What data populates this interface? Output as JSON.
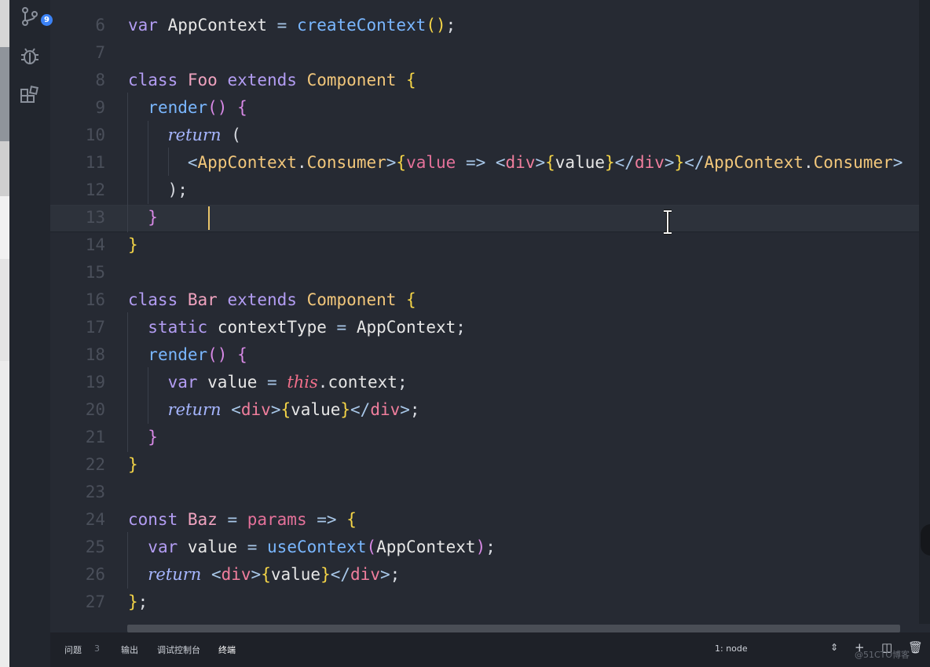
{
  "activity_bar": {
    "icons": [
      "source-control-icon",
      "debug-icon",
      "extensions-icon"
    ],
    "source_control_badge": "9"
  },
  "editor": {
    "lines": [
      {
        "n": "6",
        "tokens": [
          [
            "kw",
            "var "
          ],
          [
            "id",
            "AppContext "
          ],
          [
            "op",
            "= "
          ],
          [
            "fn",
            "createContext"
          ],
          [
            "br",
            "()"
          ],
          [
            "code",
            ";"
          ]
        ]
      },
      {
        "n": "7",
        "tokens": []
      },
      {
        "n": "8",
        "tokens": [
          [
            "kw",
            "class "
          ],
          [
            "ctor",
            "Foo "
          ],
          [
            "kw",
            "extends "
          ],
          [
            "sup",
            "Component "
          ],
          [
            "br",
            "{"
          ]
        ]
      },
      {
        "n": "9",
        "tokens": [
          [
            "code",
            "  "
          ],
          [
            "fn",
            "render"
          ],
          [
            "br2",
            "() {"
          ]
        ]
      },
      {
        "n": "10",
        "tokens": [
          [
            "code",
            "    "
          ],
          [
            "ret it",
            "return"
          ],
          [
            "code",
            " ("
          ]
        ]
      },
      {
        "n": "11",
        "tokens": [
          [
            "code",
            "      "
          ],
          [
            "op",
            "<"
          ],
          [
            "comp",
            "AppContext"
          ],
          [
            "code",
            "."
          ],
          [
            "comp",
            "Consumer"
          ],
          [
            "op",
            ">"
          ],
          [
            "br",
            "{"
          ],
          [
            "prm",
            "value "
          ],
          [
            "op",
            "=> "
          ],
          [
            "op",
            "<"
          ],
          [
            "tag",
            "div"
          ],
          [
            "op",
            ">"
          ],
          [
            "br",
            "{"
          ],
          [
            "id",
            "value"
          ],
          [
            "br",
            "}"
          ],
          [
            "op",
            "</"
          ],
          [
            "tag",
            "div"
          ],
          [
            "op",
            ">"
          ],
          [
            "br",
            "}"
          ],
          [
            "op",
            "</"
          ],
          [
            "comp",
            "AppContext"
          ],
          [
            "code",
            "."
          ],
          [
            "comp",
            "Consumer"
          ],
          [
            "op",
            ">"
          ]
        ]
      },
      {
        "n": "12",
        "tokens": [
          [
            "code",
            "    );"
          ]
        ]
      },
      {
        "n": "13",
        "tokens": [
          [
            "code",
            "  "
          ],
          [
            "br2",
            "}"
          ]
        ]
      },
      {
        "n": "14",
        "tokens": [
          [
            "br",
            "}"
          ]
        ]
      },
      {
        "n": "15",
        "tokens": []
      },
      {
        "n": "16",
        "tokens": [
          [
            "kw",
            "class "
          ],
          [
            "ctor",
            "Bar "
          ],
          [
            "kw",
            "extends "
          ],
          [
            "sup",
            "Component "
          ],
          [
            "br",
            "{"
          ]
        ]
      },
      {
        "n": "17",
        "tokens": [
          [
            "code",
            "  "
          ],
          [
            "kw",
            "static "
          ],
          [
            "id",
            "contextType "
          ],
          [
            "op",
            "= "
          ],
          [
            "id",
            "AppContext"
          ],
          [
            "code",
            ";"
          ]
        ]
      },
      {
        "n": "18",
        "tokens": [
          [
            "code",
            "  "
          ],
          [
            "fn",
            "render"
          ],
          [
            "br2",
            "() {"
          ]
        ]
      },
      {
        "n": "19",
        "tokens": [
          [
            "code",
            "    "
          ],
          [
            "kw",
            "var "
          ],
          [
            "id",
            "value "
          ],
          [
            "op",
            "= "
          ],
          [
            "thisk it",
            "this"
          ],
          [
            "code",
            "."
          ],
          [
            "id",
            "context"
          ],
          [
            "code",
            ";"
          ]
        ]
      },
      {
        "n": "20",
        "tokens": [
          [
            "code",
            "    "
          ],
          [
            "ret it",
            "return"
          ],
          [
            "code",
            " "
          ],
          [
            "op",
            "<"
          ],
          [
            "tag",
            "div"
          ],
          [
            "op",
            ">"
          ],
          [
            "br",
            "{"
          ],
          [
            "id",
            "value"
          ],
          [
            "br",
            "}"
          ],
          [
            "op",
            "</"
          ],
          [
            "tag",
            "div"
          ],
          [
            "op",
            ">"
          ],
          [
            "code",
            ";"
          ]
        ]
      },
      {
        "n": "21",
        "tokens": [
          [
            "code",
            "  "
          ],
          [
            "br2",
            "}"
          ]
        ]
      },
      {
        "n": "22",
        "tokens": [
          [
            "br",
            "}"
          ]
        ]
      },
      {
        "n": "23",
        "tokens": []
      },
      {
        "n": "24",
        "tokens": [
          [
            "kw",
            "const "
          ],
          [
            "ctor",
            "Baz "
          ],
          [
            "op",
            "= "
          ],
          [
            "prm",
            "params "
          ],
          [
            "op",
            "=> "
          ],
          [
            "br",
            "{"
          ]
        ]
      },
      {
        "n": "25",
        "tokens": [
          [
            "code",
            "  "
          ],
          [
            "kw",
            "var "
          ],
          [
            "id",
            "value "
          ],
          [
            "op",
            "= "
          ],
          [
            "fn",
            "useContext"
          ],
          [
            "br2",
            "("
          ],
          [
            "id",
            "AppContext"
          ],
          [
            "br2",
            ")"
          ],
          [
            "code",
            ";"
          ]
        ]
      },
      {
        "n": "26",
        "tokens": [
          [
            "code",
            "  "
          ],
          [
            "ret it",
            "return"
          ],
          [
            "code",
            " "
          ],
          [
            "op",
            "<"
          ],
          [
            "tag",
            "div"
          ],
          [
            "op",
            ">"
          ],
          [
            "br",
            "{"
          ],
          [
            "id",
            "value"
          ],
          [
            "br",
            "}"
          ],
          [
            "op",
            "</"
          ],
          [
            "tag",
            "div"
          ],
          [
            "op",
            ">"
          ],
          [
            "code",
            ";"
          ]
        ]
      },
      {
        "n": "27",
        "tokens": [
          [
            "br",
            "}"
          ],
          [
            "code",
            ";"
          ]
        ]
      }
    ]
  },
  "panel": {
    "tabs": [
      "问题",
      "输出",
      "调试控制台",
      "终端"
    ],
    "problems_count": "3",
    "terminal_select": "1: node",
    "icons": [
      "add-icon",
      "split-icon",
      "trash-icon"
    ]
  },
  "watermark": "@51CTO博客",
  "colors": {
    "background": "#262a33",
    "activity_bar": "#22262e",
    "badge": "#3b82f6",
    "panel": "#1e2128"
  }
}
